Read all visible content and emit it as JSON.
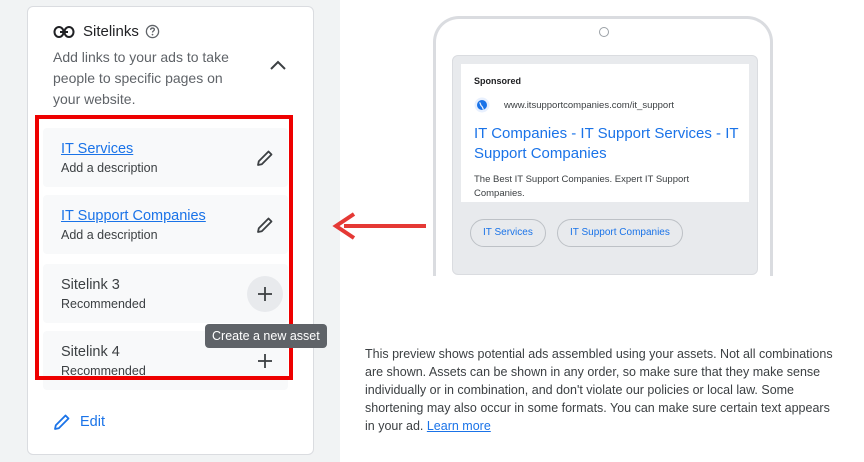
{
  "sitelinks": {
    "title": "Sitelinks",
    "subtitle": "Add links to your ads to take people to specific pages on your website.",
    "rows": [
      {
        "title": "IT Services",
        "desc": "Add a description"
      },
      {
        "title": "IT Support Companies",
        "desc": "Add a description"
      },
      {
        "title": "Sitelink 3",
        "desc": "Recommended"
      },
      {
        "title": "Sitelink 4",
        "desc": "Recommended"
      }
    ],
    "tooltip": "Create a new asset",
    "edit_label": "Edit"
  },
  "preview": {
    "sponsored": "Sponsored",
    "url": "www.itsupportcompanies.com/it_support",
    "headline": "IT Companies - IT Support Services - IT Support Companies",
    "description": "The Best IT Support Companies. Expert IT Support Companies.",
    "chips": [
      "IT Services",
      "IT Support Companies"
    ],
    "disclaimer": "This preview shows potential ads assembled using your assets. Not all combinations are shown. Assets can be shown in any order, so make sure that they make sense individually or in combination, and don't violate our policies or local law. Some shortening may also occur in some formats. You can make sure certain text appears in your ad.",
    "learn_more": "Learn more"
  },
  "colors": {
    "accent": "#1a73e8",
    "highlight": "#ee0000",
    "arrow": "#e53935"
  },
  "icons": [
    "link-icon",
    "help-icon",
    "chevron-up-icon",
    "pencil-icon",
    "plus-icon",
    "globe-icon",
    "arrow-left-icon"
  ]
}
